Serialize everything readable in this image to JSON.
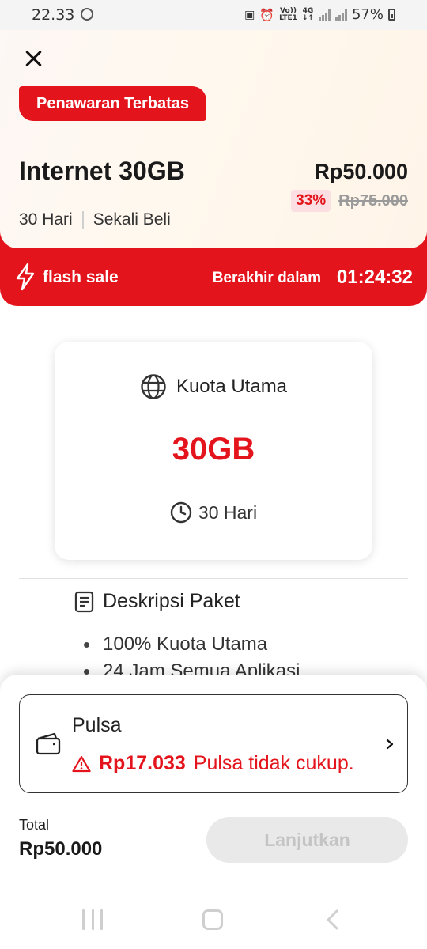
{
  "status_bar": {
    "time": "22.33",
    "volte_top": "Vo))",
    "volte_bottom": "LTE1",
    "net_top": "4G",
    "net_bottom": "↓↑",
    "battery": "57%"
  },
  "header": {
    "badge": "Penawaran Terbatas",
    "title": "Internet 30GB",
    "price": "Rp50.000",
    "discount": "33%",
    "old_price": "Rp75.000",
    "duration": "30 Hari",
    "purchase_type": "Sekali Beli",
    "flash_label": "flash sale",
    "ends_label": "Berakhir dalam",
    "countdown": "01:24:32"
  },
  "quota_card": {
    "label": "Kuota Utama",
    "value": "30GB",
    "duration": "30 Hari"
  },
  "description": {
    "title": "Deskripsi Paket",
    "items": [
      "100% Kuota Utama",
      "24 Jam Semua Aplikasi"
    ]
  },
  "payment": {
    "method": "Pulsa",
    "balance": "Rp17.033",
    "warning": "Pulsa tidak cukup."
  },
  "footer": {
    "total_label": "Total",
    "total_value": "Rp50.000",
    "continue_label": "Lanjutkan"
  },
  "colors": {
    "accent": "#e4141c",
    "discount_bg": "#fbdfe2",
    "disabled_button": "#e9e9e9"
  },
  "icons": {
    "close": "close-icon",
    "flash": "lightning-icon",
    "quota": "globe-icon",
    "duration": "clock-icon",
    "description": "document-icon",
    "payment": "wallet-icon",
    "warning": "warning-icon",
    "chevron": "chevron-right-icon"
  }
}
